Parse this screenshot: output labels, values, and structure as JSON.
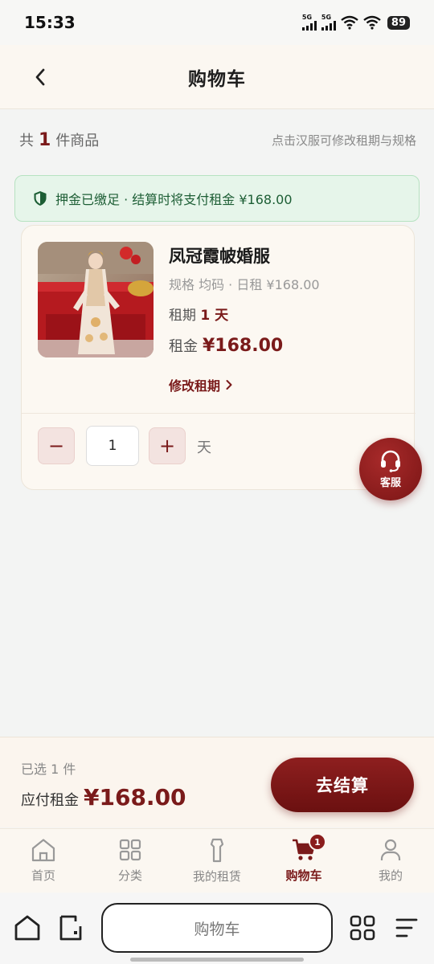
{
  "status_bar": {
    "time": "15:33",
    "sim1": "5G",
    "sim2": "5G",
    "battery": "89"
  },
  "header": {
    "title": "购物车"
  },
  "summary": {
    "prefix": "共",
    "count": "1",
    "suffix": "件商品",
    "hint": "点击汉服可修改租期与规格"
  },
  "notice": {
    "text": "押金已缴足 · 结算时将支付租金 ¥168.00"
  },
  "item": {
    "name": "凤冠霞帔婚服",
    "spec": "规格 均码 · 日租 ¥168.00",
    "period_label": "租期",
    "period_value": "1 天",
    "rent_label": "租金",
    "rent_value": "¥168.00",
    "modify_label": "修改租期",
    "quantity": "1",
    "unit": "天",
    "minus": "−",
    "plus": "+"
  },
  "service": {
    "label": "客服"
  },
  "footer": {
    "selected": "已选 1 件",
    "pay_label": "应付租金",
    "pay_amount": "¥168.00",
    "checkout": "去结算"
  },
  "tabs": [
    {
      "label": "首页",
      "icon": "home-icon"
    },
    {
      "label": "分类",
      "icon": "grid-icon"
    },
    {
      "label": "我的租赁",
      "icon": "garment-icon"
    },
    {
      "label": "购物车",
      "icon": "cart-icon",
      "badge": "1",
      "active": true
    },
    {
      "label": "我的",
      "icon": "user-icon"
    }
  ],
  "browser": {
    "url_title": "购物车"
  },
  "colors": {
    "accent": "#7a1a1a",
    "notice_bg": "#e6f5ea",
    "notice_text": "#1d5e35"
  }
}
